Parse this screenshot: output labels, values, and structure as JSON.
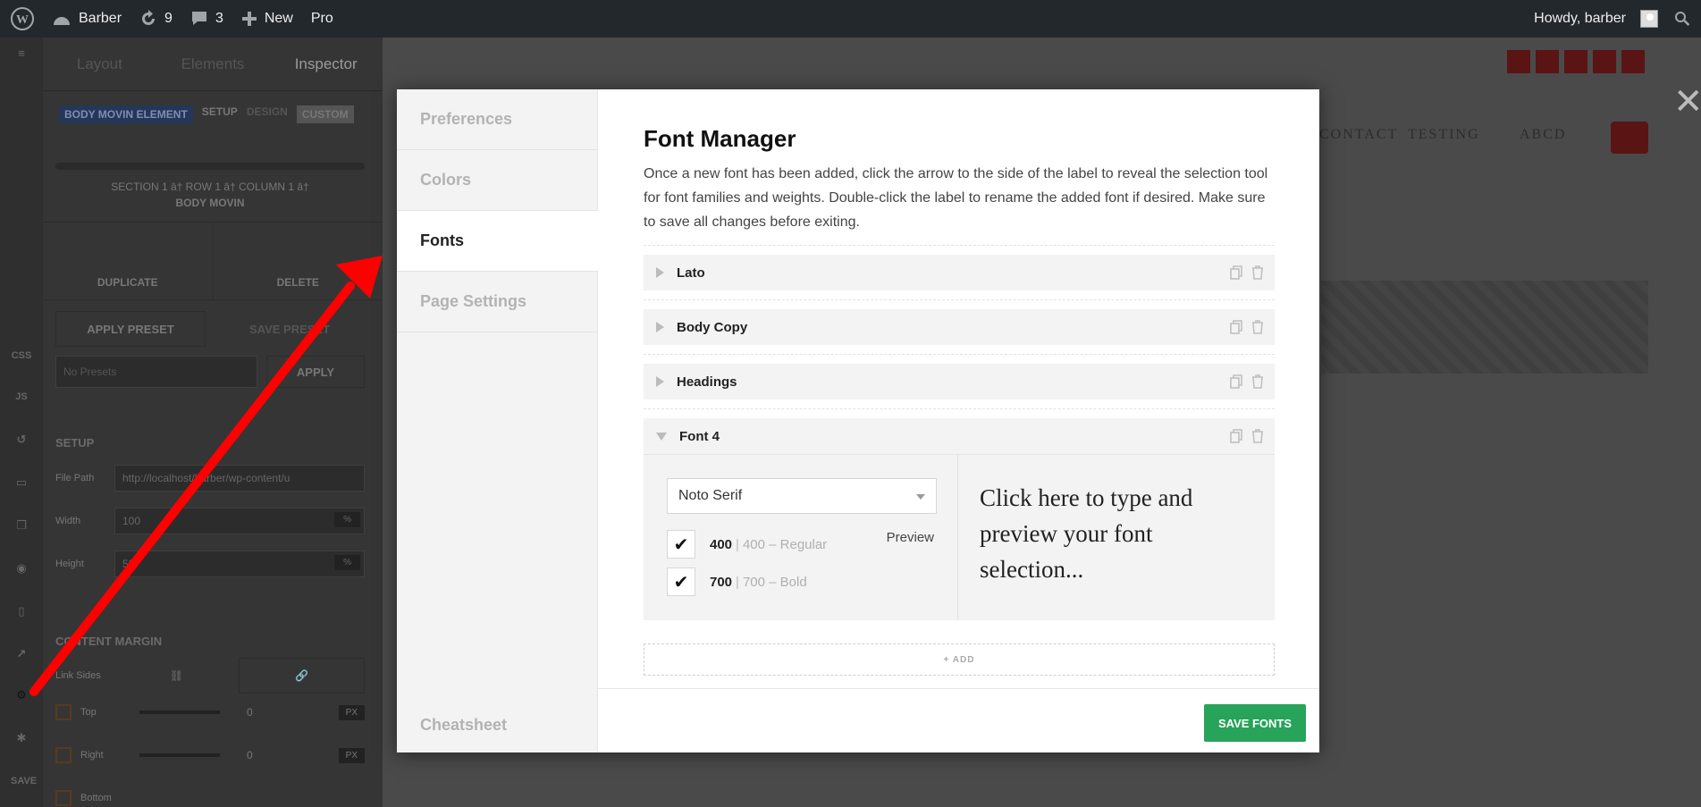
{
  "adminbar": {
    "site_name": "Barber",
    "updates_count": "9",
    "comments_count": "3",
    "new_label": "New",
    "pro_label": "Pro",
    "greeting": "Howdy, barber"
  },
  "inspector": {
    "tabs": [
      "Layout",
      "Elements",
      "Inspector"
    ],
    "crumbs": [
      "BODY MOVIN ELEMENT",
      "SETUP",
      "DESIGN",
      "CUSTOM"
    ],
    "location": "SECTION 1 â† ROW 1 â† COLUMN 1 â†",
    "element_name": "BODY MOVIN",
    "duplicate_label": "DUPLICATE",
    "delete_label": "DELETE",
    "apply_preset_label": "APPLY PRESET",
    "save_preset_label": "SAVE PRESET",
    "preset_value": "No Presets",
    "apply_label": "APPLY",
    "setup_heading": "SETUP",
    "file_path_label": "File Path",
    "file_path_value": "http://localhost/barber/wp-content/u",
    "width_label": "Width",
    "width_value": "100",
    "height_label": "Height",
    "height_value": "50",
    "unit_percent": "%",
    "content_margin_heading": "CONTENT MARGIN",
    "link_sides_label": "Link Sides",
    "top_label": "Top",
    "right_label": "Right",
    "bottom_label": "Bottom",
    "margin_value": "0",
    "unit_px": "PX"
  },
  "rail": {
    "css_label": "CSS",
    "js_label": "JS",
    "save_label": "SAVE"
  },
  "page": {
    "nav": [
      "CONTACT",
      "TESTING",
      "ABCD"
    ]
  },
  "modal": {
    "sidebar": {
      "items": [
        "Preferences",
        "Colors",
        "Fonts",
        "Page Settings"
      ],
      "active": "Fonts",
      "cheatsheet": "Cheatsheet"
    },
    "title": "Font Manager",
    "description": "Once a new font has been added, click the arrow to the side of the label to reveal the selection tool for font families and weights. Double-click the label to rename the added font if desired. Make sure to save all changes before exiting.",
    "fonts": [
      {
        "name": "Lato"
      },
      {
        "name": "Body Copy"
      },
      {
        "name": "Headings"
      },
      {
        "name": "Font 4"
      }
    ],
    "expanded": {
      "family": "Noto Serif",
      "preview_label": "Preview",
      "weights": [
        {
          "num": "400",
          "name": "400 – Regular",
          "checked": true
        },
        {
          "num": "700",
          "name": "700 – Bold",
          "checked": true
        }
      ],
      "preview_text": "Click here to type and preview your font selection..."
    },
    "add_label": "+ ADD",
    "save_label": "SAVE FONTS"
  },
  "colors": {
    "accent_green": "#27a35a",
    "annotation_red": "#ff0000",
    "adminbar_bg": "#23282d"
  }
}
